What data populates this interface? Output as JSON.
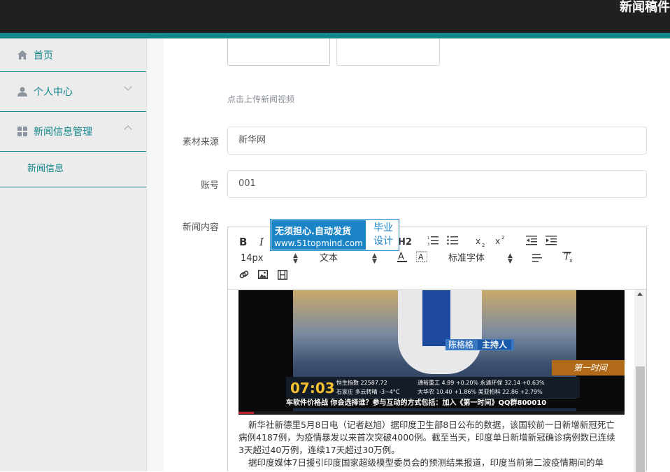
{
  "header": {
    "title": "新闻稿件"
  },
  "sidebar": {
    "items": [
      {
        "label": "首页",
        "icon": "home-icon"
      },
      {
        "label": "个人中心",
        "icon": "user-icon"
      },
      {
        "label": "新闻信息管理",
        "icon": "grid-icon"
      }
    ],
    "sub_items": [
      {
        "label": "新闻信息"
      }
    ]
  },
  "form": {
    "upload_hint": "点击上传新闻视频",
    "source_label": "素材来源",
    "source_value": "新华网",
    "account_label": "账号",
    "account_value": "001",
    "content_label": "新闻内容"
  },
  "editor": {
    "toolbar": {
      "bold": "B",
      "italic": "I",
      "heading": "H2",
      "font_size": "14px",
      "block_type": "文本",
      "font_family": "标准字体"
    },
    "ad": {
      "line1": "无须担心.自动发货",
      "line2": "www.51topmind.com",
      "badge1": "毕业",
      "badge2": "设计"
    },
    "video": {
      "anchor_name": "陈格格",
      "anchor_role": "主持人",
      "show_name": "第一时间",
      "clock": "07:03",
      "ticker_1": "恒生指数    22587.72",
      "ticker_2": "石家庄 多云转晴  -3~4°C",
      "ticker_3": "通裕重工 4.89 +0.20% 永清环保 32.14 +0.63%",
      "ticker_4": "大华农  10.40 +1.86% 美亚柏科 22.86 +2.79%",
      "crawl": "车软件价格战 你会选择谁？参与互动的方式包括：加入《第一时间》QQ群800010",
      "progress": 0.04
    },
    "paragraphs": [
      "新华社新德里5月8日电（记者赵旭）据印度卫生部8日公布的数据，该国较前一日新增新冠死亡病例4187例，为疫情暴发以来首次突破4000例。截至当天，印度单日新增新冠确诊病例数已连续3天超过40万例，连续17天超过30万例。",
      "据印度媒体7日援引印度国家超级模型委员会的预测结果报道，印度当前第二波疫情期间的单"
    ]
  },
  "colors": {
    "accent": "#12868a",
    "topbar": "#202020",
    "ad_blue": "#1a84c7"
  }
}
